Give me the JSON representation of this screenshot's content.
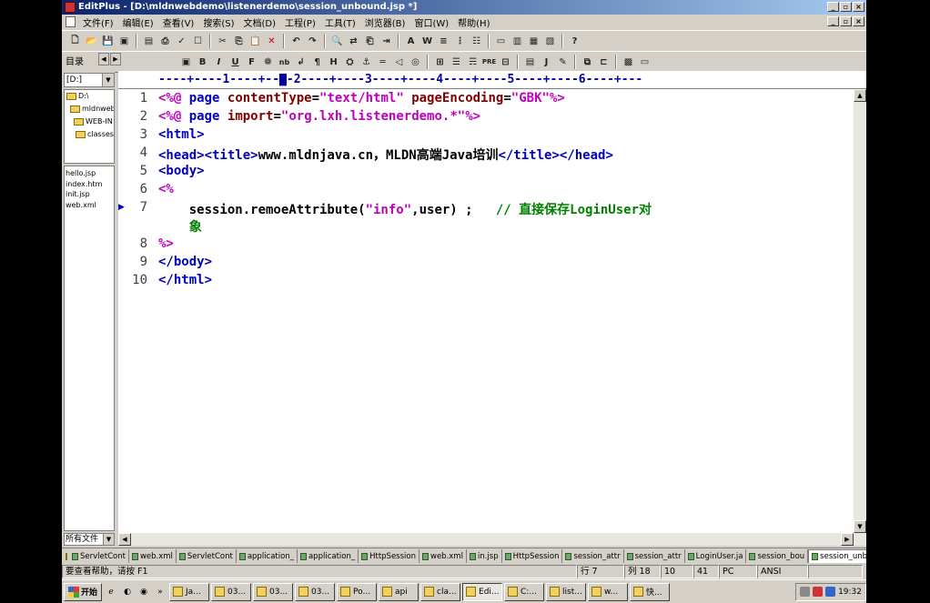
{
  "window": {
    "title": "EditPlus - [D:\\mldnwebdemo\\listenerdemo\\session_unbound.jsp *]"
  },
  "menu": [
    "文件(F)",
    "编辑(E)",
    "查看(V)",
    "搜索(S)",
    "文档(D)",
    "工程(P)",
    "工具(T)",
    "浏览器(B)",
    "窗口(W)",
    "帮助(H)"
  ],
  "directory": {
    "label": "目录",
    "drive": "[D:]",
    "tree": [
      "D:\\",
      "mldnweb",
      "WEB-IN",
      "classes"
    ]
  },
  "files": [
    "hello.jsp",
    "index.htm",
    "init.jsp",
    "web.xml"
  ],
  "file_type": "所有文件",
  "ruler": "----+----1----+--▇-2----+----3----+----4----+----5----+----6----+---",
  "code": [
    {
      "n": "1",
      "text": "<%@ page contentType=\"text/html\" pageEncoding=\"GBK\"%>"
    },
    {
      "n": "2",
      "text": "<%@ page import=\"org.lxh.listenerdemo.*\"%>"
    },
    {
      "n": "3",
      "text": "<html>"
    },
    {
      "n": "4",
      "text": "<head><title>www.mldnjava.cn，MLDN高端Java培训</title></head>"
    },
    {
      "n": "5",
      "text": "<body>"
    },
    {
      "n": "6",
      "text": "<%"
    },
    {
      "n": "7",
      "text": "    session.remoeAttribute(\"info\",user) ;   // 直接保存LoginUser对"
    },
    {
      "n": "",
      "text": "    象"
    },
    {
      "n": "8",
      "text": "%>"
    },
    {
      "n": "9",
      "text": "</body>"
    },
    {
      "n": "10",
      "text": "</html>"
    }
  ],
  "tabs": [
    "ServletCont",
    "web.xml",
    "ServletCont",
    "application_",
    "application_",
    "HttpSession",
    "web.xml",
    "in.jsp",
    "HttpSession",
    "session_attr",
    "session_attr",
    "LoginUser.ja",
    "session_bou",
    "session_unb"
  ],
  "status": {
    "help": "要查看帮助，请按 F1",
    "row": "行 7",
    "col": "列 18",
    "c3": "10",
    "c4": "41",
    "mode": "PC",
    "enc": "ANSI"
  },
  "taskbar": {
    "start": "开始",
    "items": [
      "Ja...",
      "03...",
      "03...",
      "03...",
      "Po...",
      "api",
      "cla...",
      "Edi...",
      "C:...",
      "list...",
      "w...",
      "快..."
    ],
    "clock": "19:32"
  }
}
